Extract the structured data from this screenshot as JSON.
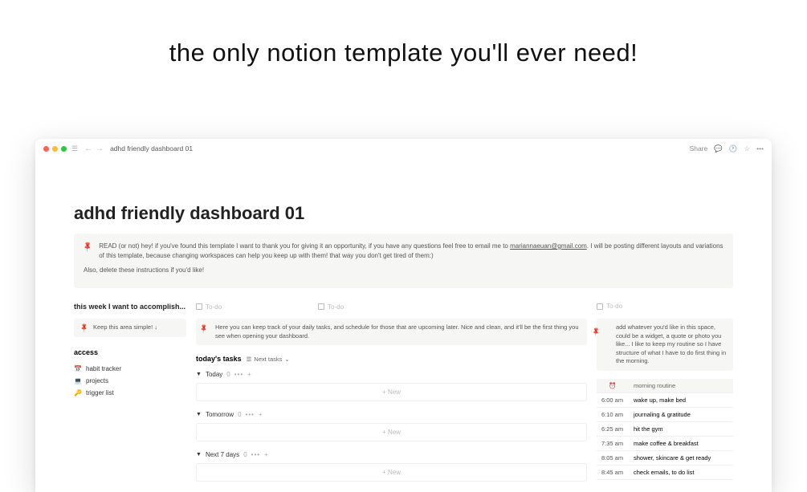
{
  "headline": "the only notion template you'll ever need!",
  "breadcrumb": "adhd friendly dashboard 01",
  "toolbar": {
    "share": "Share"
  },
  "page_title": "adhd friendly dashboard 01",
  "main_callout": {
    "p1_prefix": "READ (or not) hey! if you've found this template I want to thank you for giving it an opportunity, if you have any questions feel free to email me to ",
    "email": "mariannaeuan@gmail.com",
    "p1_suffix": ". I will be posting different layouts and variations of this template, because changing workspaces can help you keep up with them! that way you don't get tired of them:)",
    "p2": "Also, delete these instructions if you'd like!"
  },
  "section_heading": "this week I want to accomplish...",
  "todo_label": "To-do",
  "left_callout": "Keep this area simple! ↓",
  "mid_callout": "Here you can keep track of your daily tasks, and schedule for those that are upcoming later. Nice and clean, and it'll be the first thing you see when opening your dashboard.",
  "right_callout": "add whatever you'd like in this space, could be a widget, a quote or photo you like... I like to keep my routine so I have structure of what I have to do first thing in the morning.",
  "access": {
    "title": "access",
    "items": [
      {
        "icon": "📅",
        "label": "habit tracker"
      },
      {
        "icon": "💻",
        "label": "projects"
      },
      {
        "icon": "🔑",
        "label": "trigger list"
      }
    ]
  },
  "tasks": {
    "title": "today's tasks",
    "view_label": "Next tasks",
    "groups": [
      {
        "name": "Today",
        "count": "0"
      },
      {
        "name": "Tomorrow",
        "count": "0"
      },
      {
        "name": "Next 7 days",
        "count": "0"
      }
    ],
    "new_label": "+   New"
  },
  "routine": {
    "header_icon": "⏰",
    "header_label": "morning routine",
    "rows": [
      {
        "time": "6:00 am",
        "task": "wake up, make bed"
      },
      {
        "time": "6:10 am",
        "task": "journaling & gratitude"
      },
      {
        "time": "6:25 am",
        "task": "hit the gym"
      },
      {
        "time": "7:35 am",
        "task": "make coffee & breakfast"
      },
      {
        "time": "8:05 am",
        "task": "shower, skincare & get ready"
      },
      {
        "time": "8:45 am",
        "task": "check emails, to do list"
      }
    ]
  }
}
